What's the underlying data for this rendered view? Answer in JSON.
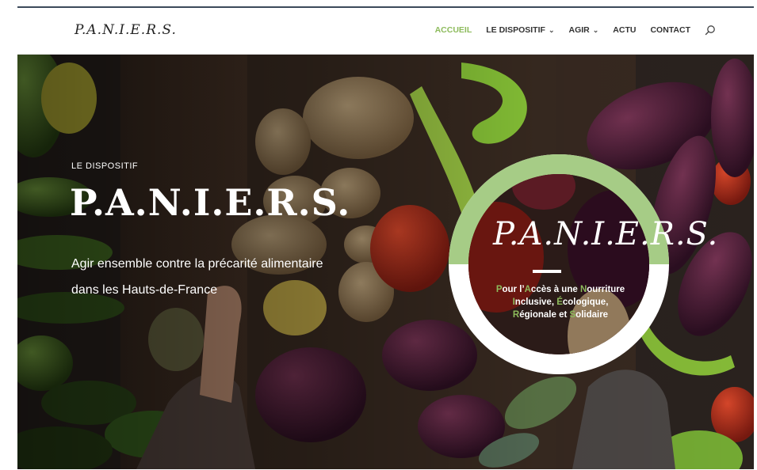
{
  "header": {
    "logo": "P.A.N.I.E.R.S.",
    "nav": [
      {
        "label": "ACCUEIL",
        "active": true,
        "dropdown": false
      },
      {
        "label": "LE DISPOSITIF",
        "active": false,
        "dropdown": true
      },
      {
        "label": "AGIR",
        "active": false,
        "dropdown": true
      },
      {
        "label": "ACTU",
        "active": false,
        "dropdown": false
      },
      {
        "label": "CONTACT",
        "active": false,
        "dropdown": false
      }
    ],
    "search_icon": "search-icon"
  },
  "hero": {
    "eyebrow": "LE DISPOSITIF",
    "title": "P.A.N.I.E.R.S.",
    "subtitle_line1": "Agir ensemble contre la précarité alimentaire",
    "subtitle_line2": "dans les Hauts-de-France",
    "badge": {
      "logo": "P.A.N.I.E.R.S.",
      "line1_a": "P",
      "line1_b": "our l’",
      "line1_c": "A",
      "line1_d": "ccès à une ",
      "line1_e": "N",
      "line1_f": "ourriture",
      "line2_a": "I",
      "line2_b": "nclusive, ",
      "line2_c": "É",
      "line2_d": "cologique,",
      "line3_a": "R",
      "line3_b": "égionale et ",
      "line3_c": "S",
      "line3_d": "olidaire"
    }
  },
  "colors": {
    "accent": "#8dbb5c",
    "nav_text": "#333333",
    "badge_ring_top": "#a6cc86",
    "badge_ring_bottom": "#ffffff"
  }
}
